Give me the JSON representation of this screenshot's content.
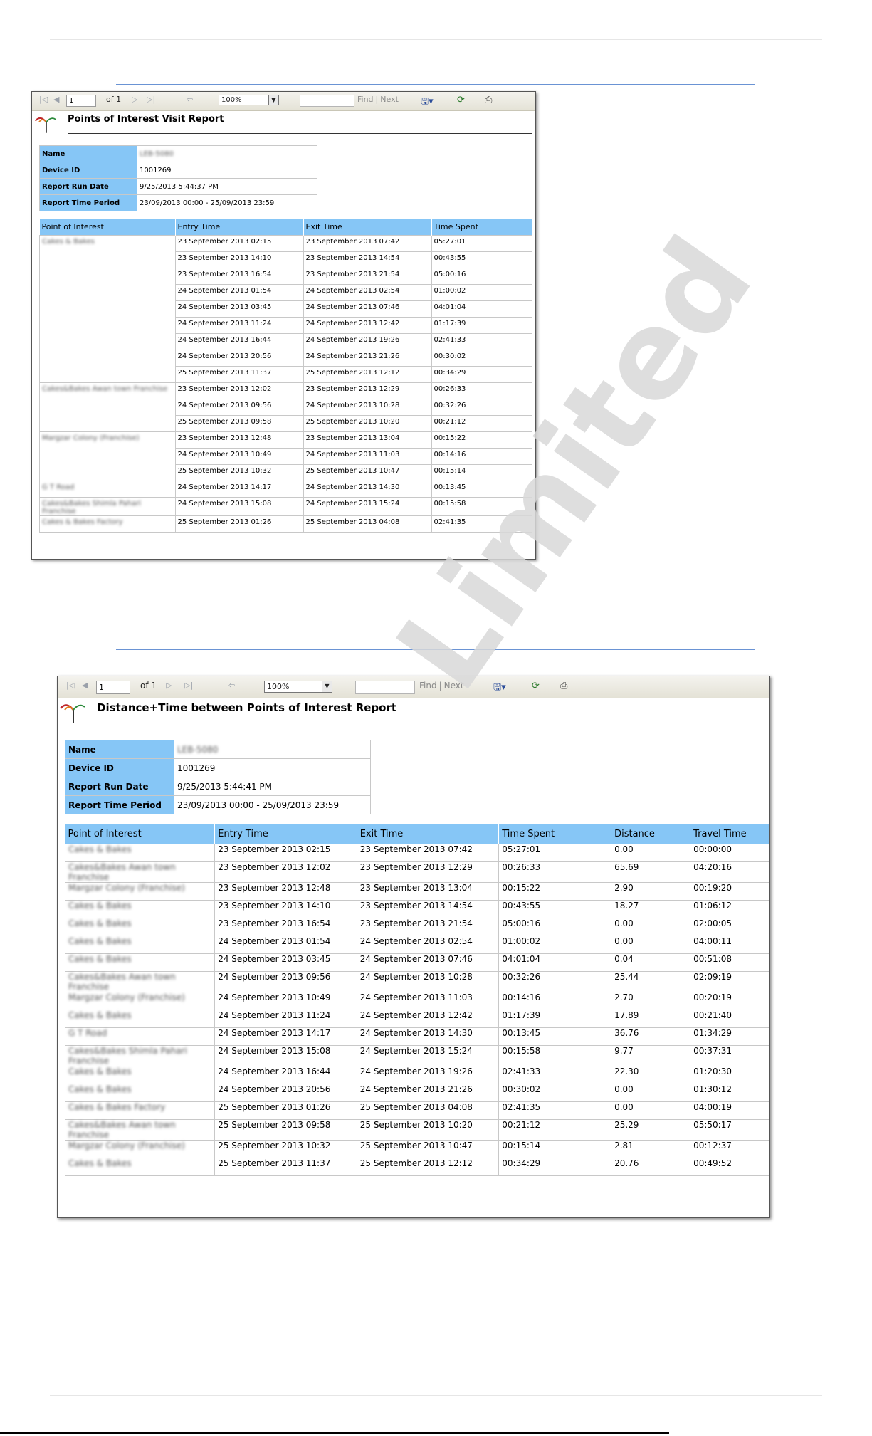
{
  "toolbar": {
    "page": "1",
    "of_pages": "of 1",
    "zoom": "100%",
    "find": "Find",
    "next": "Next"
  },
  "report1": {
    "title": "Points of Interest Visit Report",
    "info": [
      {
        "key": "Name",
        "value": "LEB-5080"
      },
      {
        "key": "Device ID",
        "value": "1001269"
      },
      {
        "key": "Report Run Date",
        "value": "9/25/2013 5:44:37 PM"
      },
      {
        "key": "Report Time Period",
        "value": "23/09/2013 00:00 - 25/09/2013 23:59"
      }
    ],
    "columns": [
      "Point of Interest",
      "Entry Time",
      "Exit Time",
      "Time Spent"
    ],
    "groups": [
      {
        "poi": "Cakes & Bakes",
        "rows": [
          [
            "23 September 2013 02:15",
            "23 September 2013 07:42",
            "05:27:01"
          ],
          [
            "23 September 2013 14:10",
            "23 September 2013 14:54",
            "00:43:55"
          ],
          [
            "23 September 2013 16:54",
            "23 September 2013 21:54",
            "05:00:16"
          ],
          [
            "24 September 2013 01:54",
            "24 September 2013 02:54",
            "01:00:02"
          ],
          [
            "24 September 2013 03:45",
            "24 September 2013 07:46",
            "04:01:04"
          ],
          [
            "24 September 2013 11:24",
            "24 September 2013 12:42",
            "01:17:39"
          ],
          [
            "24 September 2013 16:44",
            "24 September 2013 19:26",
            "02:41:33"
          ],
          [
            "24 September 2013 20:56",
            "24 September 2013 21:26",
            "00:30:02"
          ],
          [
            "25 September 2013 11:37",
            "25 September 2013 12:12",
            "00:34:29"
          ]
        ]
      },
      {
        "poi": "Cakes&Bakes Awan town Franchise",
        "rows": [
          [
            "23 September 2013 12:02",
            "23 September 2013 12:29",
            "00:26:33"
          ],
          [
            "24 September 2013 09:56",
            "24 September 2013 10:28",
            "00:32:26"
          ],
          [
            "25 September 2013 09:58",
            "25 September 2013 10:20",
            "00:21:12"
          ]
        ]
      },
      {
        "poi": "Margzar Colony (Franchise)",
        "rows": [
          [
            "23 September 2013 12:48",
            "23 September 2013 13:04",
            "00:15:22"
          ],
          [
            "24 September 2013 10:49",
            "24 September 2013 11:03",
            "00:14:16"
          ],
          [
            "25 September 2013 10:32",
            "25 September 2013 10:47",
            "00:15:14"
          ]
        ]
      },
      {
        "poi": "G T Road",
        "rows": [
          [
            "24 September 2013 14:17",
            "24 September 2013 14:30",
            "00:13:45"
          ]
        ]
      },
      {
        "poi": "Cakes&Bakes Shimla Pahari Franchise",
        "rows": [
          [
            "24 September 2013 15:08",
            "24 September 2013 15:24",
            "00:15:58"
          ]
        ]
      },
      {
        "poi": "Cakes & Bakes Factory",
        "rows": [
          [
            "25 September 2013 01:26",
            "25 September 2013 04:08",
            "02:41:35"
          ]
        ]
      }
    ]
  },
  "report2": {
    "title": "Distance+Time between Points of Interest Report",
    "info": [
      {
        "key": "Name",
        "value": "LEB-5080"
      },
      {
        "key": "Device ID",
        "value": "1001269"
      },
      {
        "key": "Report Run Date",
        "value": "9/25/2013 5:44:41 PM"
      },
      {
        "key": "Report Time Period",
        "value": "23/09/2013 00:00 - 25/09/2013 23:59"
      }
    ],
    "columns": [
      "Point of Interest",
      "Entry Time",
      "Exit Time",
      "Time Spent",
      "Distance",
      "Travel Time"
    ],
    "rows": [
      [
        "Cakes & Bakes",
        "23 September 2013 02:15",
        "23 September 2013 07:42",
        "05:27:01",
        "0.00",
        "00:00:00"
      ],
      [
        "Cakes&Bakes Awan town Franchise",
        "23 September 2013 12:02",
        "23 September 2013 12:29",
        "00:26:33",
        "65.69",
        "04:20:16"
      ],
      [
        "Margzar Colony (Franchise)",
        "23 September 2013 12:48",
        "23 September 2013 13:04",
        "00:15:22",
        "2.90",
        "00:19:20"
      ],
      [
        "Cakes & Bakes",
        "23 September 2013 14:10",
        "23 September 2013 14:54",
        "00:43:55",
        "18.27",
        "01:06:12"
      ],
      [
        "Cakes & Bakes",
        "23 September 2013 16:54",
        "23 September 2013 21:54",
        "05:00:16",
        "0.00",
        "02:00:05"
      ],
      [
        "Cakes & Bakes",
        "24 September 2013 01:54",
        "24 September 2013 02:54",
        "01:00:02",
        "0.00",
        "04:00:11"
      ],
      [
        "Cakes & Bakes",
        "24 September 2013 03:45",
        "24 September 2013 07:46",
        "04:01:04",
        "0.04",
        "00:51:08"
      ],
      [
        "Cakes&Bakes Awan town Franchise",
        "24 September 2013 09:56",
        "24 September 2013 10:28",
        "00:32:26",
        "25.44",
        "02:09:19"
      ],
      [
        "Margzar Colony (Franchise)",
        "24 September 2013 10:49",
        "24 September 2013 11:03",
        "00:14:16",
        "2.70",
        "00:20:19"
      ],
      [
        "Cakes & Bakes",
        "24 September 2013 11:24",
        "24 September 2013 12:42",
        "01:17:39",
        "17.89",
        "00:21:40"
      ],
      [
        "G T Road",
        "24 September 2013 14:17",
        "24 September 2013 14:30",
        "00:13:45",
        "36.76",
        "01:34:29"
      ],
      [
        "Cakes&Bakes Shimla Pahari Franchise",
        "24 September 2013 15:08",
        "24 September 2013 15:24",
        "00:15:58",
        "9.77",
        "00:37:31"
      ],
      [
        "Cakes & Bakes",
        "24 September 2013 16:44",
        "24 September 2013 19:26",
        "02:41:33",
        "22.30",
        "01:20:30"
      ],
      [
        "Cakes & Bakes",
        "24 September 2013 20:56",
        "24 September 2013 21:26",
        "00:30:02",
        "0.00",
        "01:30:12"
      ],
      [
        "Cakes & Bakes Factory",
        "25 September 2013 01:26",
        "25 September 2013 04:08",
        "02:41:35",
        "0.00",
        "04:00:19"
      ],
      [
        "Cakes&Bakes Awan town Franchise",
        "25 September 2013 09:58",
        "25 September 2013 10:20",
        "00:21:12",
        "25.29",
        "05:50:17"
      ],
      [
        "Margzar Colony (Franchise)",
        "25 September 2013 10:32",
        "25 September 2013 10:47",
        "00:15:14",
        "2.81",
        "00:12:37"
      ],
      [
        "Cakes & Bakes",
        "25 September 2013 11:37",
        "25 September 2013 12:12",
        "00:34:29",
        "20.76",
        "00:49:52"
      ]
    ]
  },
  "watermark": "Limited",
  "colors": {
    "header_blue": "#86c6f6",
    "separator": "#6a93d4"
  }
}
